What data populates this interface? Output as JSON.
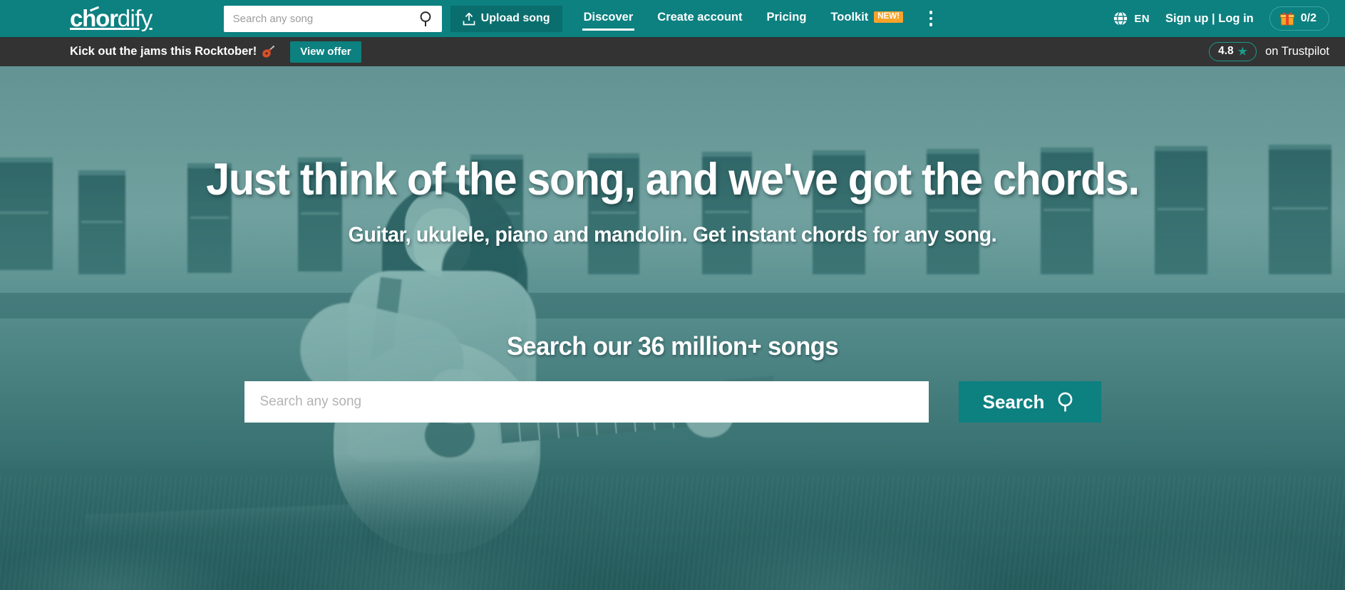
{
  "brand": {
    "logo_bold": "chor",
    "logo_light": "dify",
    "accent_teal": "#0d8080",
    "accent_teal_dark": "#0a6e6e",
    "promo_bg": "#333333",
    "badge_orange": "#f7a32a",
    "trustpilot_green": "#1a9b8a"
  },
  "topnav": {
    "search": {
      "placeholder": "Search any song",
      "value": "",
      "icon": "search-icon"
    },
    "upload": {
      "label": "Upload song",
      "icon": "upload-icon"
    },
    "links": [
      {
        "label": "Discover",
        "active": true
      },
      {
        "label": "Create account",
        "active": false
      },
      {
        "label": "Pricing",
        "active": false
      },
      {
        "label": "Toolkit",
        "active": false,
        "badge": "NEW!"
      }
    ],
    "overflow_icon": "kebab-menu-icon",
    "language": {
      "icon": "globe-icon",
      "code": "EN"
    },
    "auth": "Sign up | Log in",
    "gift": {
      "icon": "gift-icon",
      "count": "0/2"
    }
  },
  "promo": {
    "text": "Kick out the jams this Rocktober!",
    "emoji": "guitar-icon",
    "button": "View offer",
    "rating": {
      "score": "4.8",
      "star": "star-icon",
      "label": "on Trustpilot"
    }
  },
  "hero": {
    "title": "Just think of the song, and we've got the chords.",
    "subtitle": "Guitar, ukulele, piano and mandolin. Get instant chords for any song.",
    "search_label": "Search our 36 million+ songs",
    "search": {
      "placeholder": "Search any song",
      "value": ""
    },
    "search_button": "Search",
    "search_button_icon": "search-icon"
  }
}
